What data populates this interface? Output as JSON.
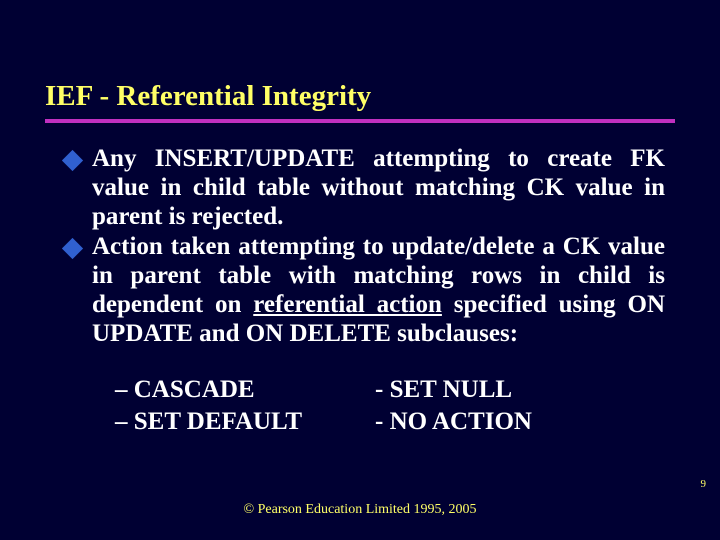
{
  "title": "IEF - Referential Integrity",
  "bullets": [
    {
      "pre": "Any INSERT/UPDATE attempting to create FK value in child table without matching CK value in parent is rejected.",
      "underlined": "",
      "post": ""
    },
    {
      "pre": "Action taken attempting to update/delete a CK value in parent table with matching rows in child is dependent on ",
      "underlined": "referential action",
      "post": " specified using ON UPDATE and ON DELETE subclauses:"
    }
  ],
  "options": {
    "left": [
      "– CASCADE",
      "– SET DEFAULT"
    ],
    "right": [
      "-  SET NULL",
      "-  NO ACTION"
    ]
  },
  "footer": "© Pearson Education Limited 1995, 2005",
  "slide_number": "9"
}
